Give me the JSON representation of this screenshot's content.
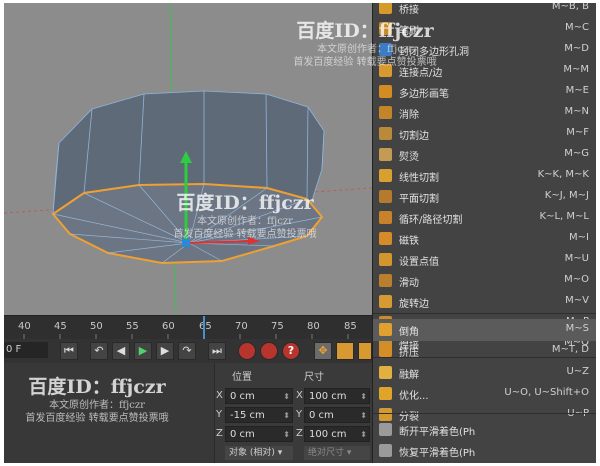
{
  "timeline": {
    "ticks": [
      "40",
      "45",
      "50",
      "55",
      "60",
      "65",
      "70",
      "75",
      "80",
      "85"
    ]
  },
  "transport": {
    "frame_value": "0 F"
  },
  "coords": {
    "position_header": "位置",
    "size_header": "尺寸",
    "rows": [
      {
        "axis": "X",
        "pos": "0 cm",
        "size_axis": "X",
        "size": "100 cm"
      },
      {
        "axis": "Y",
        "pos": "-15 cm",
        "size_axis": "Y",
        "size": "0 cm"
      },
      {
        "axis": "Z",
        "pos": "0 cm",
        "size_axis": "Z",
        "size": "100 cm"
      }
    ],
    "object_mode": "对象 (相对)",
    "size_mode": "绝对尺寸"
  },
  "menu": {
    "items": [
      {
        "label": "桥接",
        "shortcut": "M~B, B",
        "icon_color": "#d79a2a"
      },
      {
        "label": "笔刷",
        "shortcut": "M~C",
        "icon_color": "#c58a2a"
      },
      {
        "label": "封闭多边形孔洞",
        "shortcut": "M~D",
        "icon_color": "#3b7cc4"
      },
      {
        "label": "连接点/边",
        "shortcut": "M~M",
        "icon_color": "#d89a30"
      },
      {
        "label": "多边形画笔",
        "shortcut": "M~E",
        "icon_color": "#d38b24"
      },
      {
        "label": "消除",
        "shortcut": "M~N",
        "icon_color": "#c48428"
      },
      {
        "label": "切割边",
        "shortcut": "M~F",
        "icon_color": "#b98a3a"
      },
      {
        "label": "熨烫",
        "shortcut": "M~G",
        "icon_color": "#c49a55"
      },
      {
        "label": "线性切割",
        "shortcut": "K~K, M~K",
        "icon_color": "#d9a030"
      },
      {
        "label": "平面切割",
        "shortcut": "K~J, M~J",
        "icon_color": "#b57a2e"
      },
      {
        "label": "循环/路径切割",
        "shortcut": "K~L, M~L",
        "icon_color": "#c8832a"
      },
      {
        "label": "磁铁",
        "shortcut": "M~I",
        "icon_color": "#d68a28"
      },
      {
        "label": "设置点值",
        "shortcut": "M~U",
        "icon_color": "#d2962c"
      },
      {
        "label": "滑动",
        "shortcut": "M~O",
        "icon_color": "#b8802e"
      },
      {
        "label": "旋转边",
        "shortcut": "M~V",
        "icon_color": "#d59a34"
      },
      {
        "label": "缝合",
        "shortcut": "M~P",
        "icon_color": "#cf8a2a"
      },
      {
        "label": "焊接",
        "shortcut": "M~Q",
        "icon_color": "#c9902e"
      },
      {
        "label": "倒角",
        "shortcut": "M~S",
        "icon_color": "#e0a030",
        "selected": true
      },
      {
        "label": "挤压",
        "shortcut": "M~T, D",
        "icon_color": "#d58e26"
      },
      {
        "label": "融解",
        "shortcut": "U~Z",
        "icon_color": "#e2b040"
      },
      {
        "label": "优化...",
        "shortcut": "U~O, U~Shift+O",
        "icon_color": "#e0a428"
      },
      {
        "label": "分裂",
        "shortcut": "U~P",
        "icon_color": "#d39a30"
      },
      {
        "label": "断开平滑着色(Ph",
        "shortcut": "",
        "icon_color": "#9a9a9a"
      },
      {
        "label": "恢复平滑着色(Ph",
        "shortcut": "",
        "icon_color": "#9a9a9a"
      }
    ]
  },
  "watermark": {
    "line1": "百度ID：ffjczr",
    "line2": "本文原创作者：ffjczr",
    "line3": "首发百度经验  转载要点赞投票哦"
  },
  "colors": {
    "selection_orange": "#f0a030",
    "axis_green": "#2ecc40",
    "axis_red": "#e03030",
    "accent_blue": "#4a90d0"
  }
}
